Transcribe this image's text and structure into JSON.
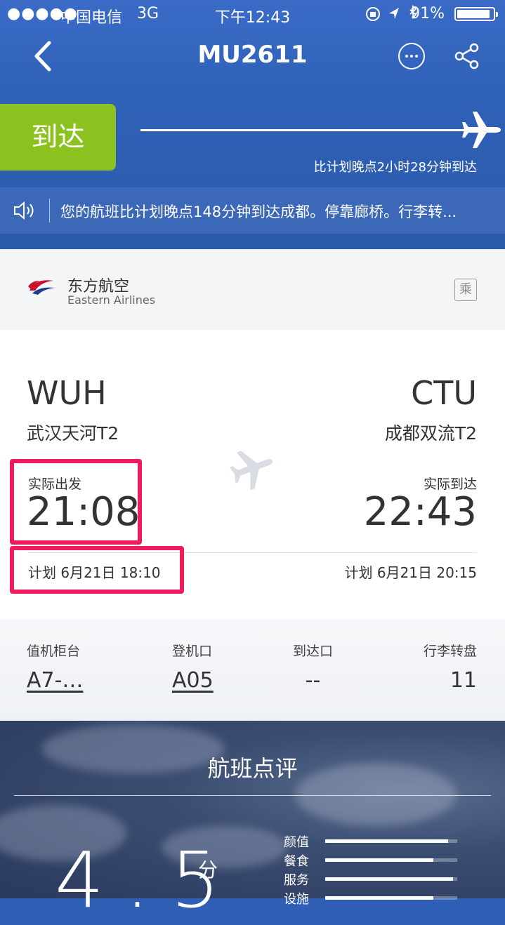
{
  "status_bar": {
    "signal": "●●●●●",
    "carrier": "中国电信",
    "network": "3G",
    "time": "下午12:43",
    "battery": "91%",
    "battery_level": 0.91
  },
  "nav": {
    "title": "MU2611"
  },
  "flight_status": {
    "badge": "到达",
    "delay_text": "比计划晚点2小时28分钟到达"
  },
  "notice": {
    "message": "您的航班比计划晚点148分钟到达成都。停靠廊桥。行李转..."
  },
  "airline": {
    "name_cn": "东方航空",
    "name_en": "Eastern Airlines",
    "ride_icon_text": "乘"
  },
  "departure": {
    "code": "WUH",
    "airport": "武汉天河T2",
    "actual_label": "实际出发",
    "actual_time": "21:08",
    "planned": "计划 6月21日 18:10"
  },
  "arrival": {
    "code": "CTU",
    "airport": "成都双流T2",
    "actual_label": "实际到达",
    "actual_time": "22:43",
    "planned": "计划 6月21日 20:15"
  },
  "info": {
    "checkin_label": "值机柜台",
    "checkin_value": "A7-…",
    "gate_label": "登机口",
    "gate_value": "A05",
    "arrival_gate_label": "到达口",
    "arrival_gate_value": "--",
    "baggage_label": "行李转盘",
    "baggage_value": "11"
  },
  "rating": {
    "title": "航班点评",
    "score": "4.5",
    "unit": "分",
    "metrics": [
      {
        "label": "颜值",
        "value": 0.93
      },
      {
        "label": "餐食",
        "value": 0.82
      },
      {
        "label": "服务",
        "value": 0.97
      },
      {
        "label": "设施",
        "value": 0.82
      }
    ]
  }
}
